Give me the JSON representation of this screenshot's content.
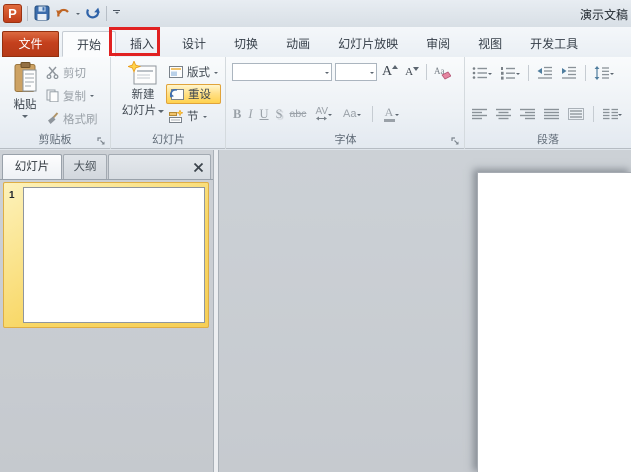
{
  "title_bar": {
    "title": "演示文稿"
  },
  "qat": {
    "icons": [
      "powerpoint-logo",
      "save-icon",
      "undo-icon",
      "redo-icon",
      "customize-quick-access-icon"
    ],
    "logo_letter": "P"
  },
  "tabs": [
    {
      "label": "文件",
      "type": "file"
    },
    {
      "label": "开始",
      "active": true
    },
    {
      "label": "插入",
      "annotated": true
    },
    {
      "label": "设计"
    },
    {
      "label": "切换"
    },
    {
      "label": "动画"
    },
    {
      "label": "幻灯片放映"
    },
    {
      "label": "审阅"
    },
    {
      "label": "视图"
    },
    {
      "label": "开发工具"
    }
  ],
  "annotation": {
    "shape": "red-box-around-insert-tab",
    "color": "#e12121"
  },
  "ribbon": {
    "clipboard": {
      "group_label": "剪贴板",
      "paste": "粘贴",
      "cut": "剪切",
      "copy": "复制",
      "format_painter": "格式刷"
    },
    "slides": {
      "group_label": "幻灯片",
      "new_slide_line1": "新建",
      "new_slide_line2": "幻灯片",
      "layout": "版式",
      "reset": "重设",
      "section": "节",
      "reset_highlight_color": "#ffd24e"
    },
    "font": {
      "group_label": "字体",
      "font_name_value": "",
      "font_size_value": "",
      "bold": "B",
      "italic": "I",
      "underline": "U",
      "shadow": "S",
      "strikethrough": "abc",
      "char_spacing": "AV",
      "change_case": "Aa",
      "grow_font": "A",
      "shrink_font": "A",
      "font_color": "A"
    },
    "paragraph": {
      "group_label": "段落"
    }
  },
  "slides_panel": {
    "tab_slides": "幻灯片",
    "tab_outline": "大纲",
    "slide_number": "1"
  },
  "colors": {
    "file_tab_orange": "#c4401d",
    "annotation_red": "#e12121",
    "thumbnail_selection_yellow": "#f6cf57",
    "reset_button_highlight": "#ffd24e"
  }
}
